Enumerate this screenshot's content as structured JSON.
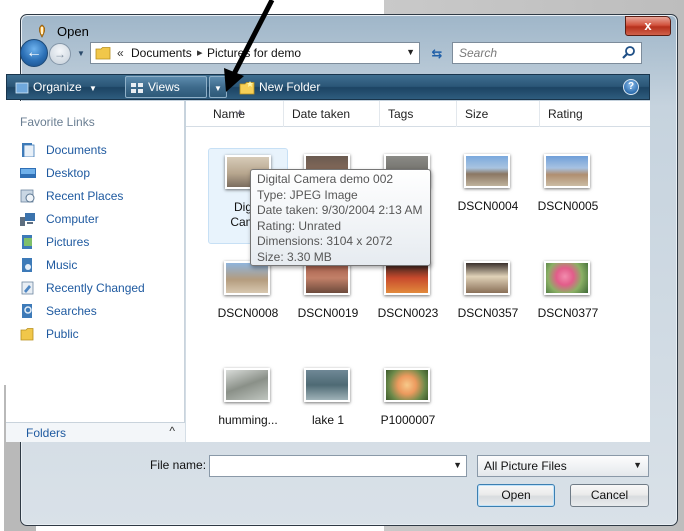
{
  "window": {
    "title": "Open",
    "close_glyph": "x"
  },
  "address": {
    "overflow_glyph": "«",
    "crumb1": "Documents",
    "separator": "▸",
    "crumb2": "Pictures for demo"
  },
  "search": {
    "placeholder": "Search"
  },
  "toolbar": {
    "organize": "Organize",
    "views": "Views",
    "new_folder": "New Folder",
    "help_glyph": "?"
  },
  "nav": {
    "header": "Favorite Links",
    "links": [
      {
        "label": "Documents",
        "icon": "documents-icon"
      },
      {
        "label": "Desktop",
        "icon": "desktop-icon"
      },
      {
        "label": "Recent Places",
        "icon": "recent-places-icon"
      },
      {
        "label": "Computer",
        "icon": "computer-icon"
      },
      {
        "label": "Pictures",
        "icon": "pictures-icon"
      },
      {
        "label": "Music",
        "icon": "music-icon"
      },
      {
        "label": "Recently Changed",
        "icon": "recently-changed-icon"
      },
      {
        "label": "Searches",
        "icon": "searches-icon"
      },
      {
        "label": "Public",
        "icon": "public-folder-icon"
      }
    ],
    "folders_label": "Folders",
    "folders_chevron": "^"
  },
  "columns": [
    "Name",
    "Date taken",
    "Tags",
    "Size",
    "Rating"
  ],
  "files": [
    {
      "label": "Dig…",
      "label2": "Cam…",
      "selected": true
    },
    {
      "label": ""
    },
    {
      "label": ""
    },
    {
      "label": "DSCN0004"
    },
    {
      "label": "DSCN0005"
    },
    {
      "label": "DSCN0008"
    },
    {
      "label": "DSCN0019"
    },
    {
      "label": "DSCN0023"
    },
    {
      "label": "DSCN0357"
    },
    {
      "label": "DSCN0377"
    },
    {
      "label": "humming..."
    },
    {
      "label": "lake 1"
    },
    {
      "label": "P1000007"
    }
  ],
  "tooltip": {
    "name": "Digital Camera demo 002",
    "type": "Type: JPEG Image",
    "date": "Date taken: 9/30/2004 2:13 AM",
    "rating": "Rating: Unrated",
    "dimensions": "Dimensions: 3104 x 2072",
    "size": "Size: 3.30 MB"
  },
  "bottom": {
    "file_name_label": "File name:",
    "file_name_value": "",
    "file_type": "All Picture Files",
    "open_button": "Open",
    "cancel_button": "Cancel"
  },
  "colors": {
    "link": "#1f5aa0",
    "toolbar": "#2a5677",
    "close": "#c8412c",
    "selection": "#e8f3fc"
  }
}
